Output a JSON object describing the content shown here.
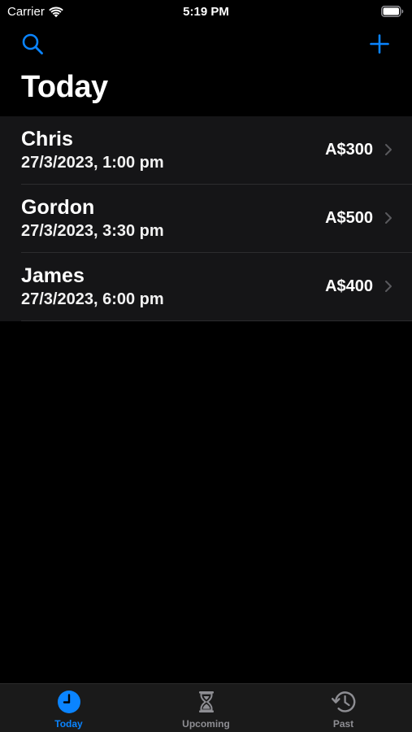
{
  "status_bar": {
    "carrier": "Carrier",
    "time": "5:19 PM"
  },
  "nav": {
    "search_icon": "search-icon",
    "add_icon": "plus-icon"
  },
  "page": {
    "title": "Today"
  },
  "appointments": [
    {
      "name": "Chris",
      "datetime": "27/3/2023, 1:00 pm",
      "amount": "A$300"
    },
    {
      "name": "Gordon",
      "datetime": "27/3/2023, 3:30 pm",
      "amount": "A$500"
    },
    {
      "name": "James",
      "datetime": "27/3/2023, 6:00 pm",
      "amount": "A$400"
    }
  ],
  "tab_bar": {
    "tabs": [
      {
        "label": "Today",
        "icon": "clock-icon",
        "active": true
      },
      {
        "label": "Upcoming",
        "icon": "hourglass-icon",
        "active": false
      },
      {
        "label": "Past",
        "icon": "history-icon",
        "active": false
      }
    ]
  },
  "colors": {
    "accent": "#0a84ff",
    "background": "#000000",
    "row_background": "#151517",
    "inactive": "#8e8e93"
  }
}
